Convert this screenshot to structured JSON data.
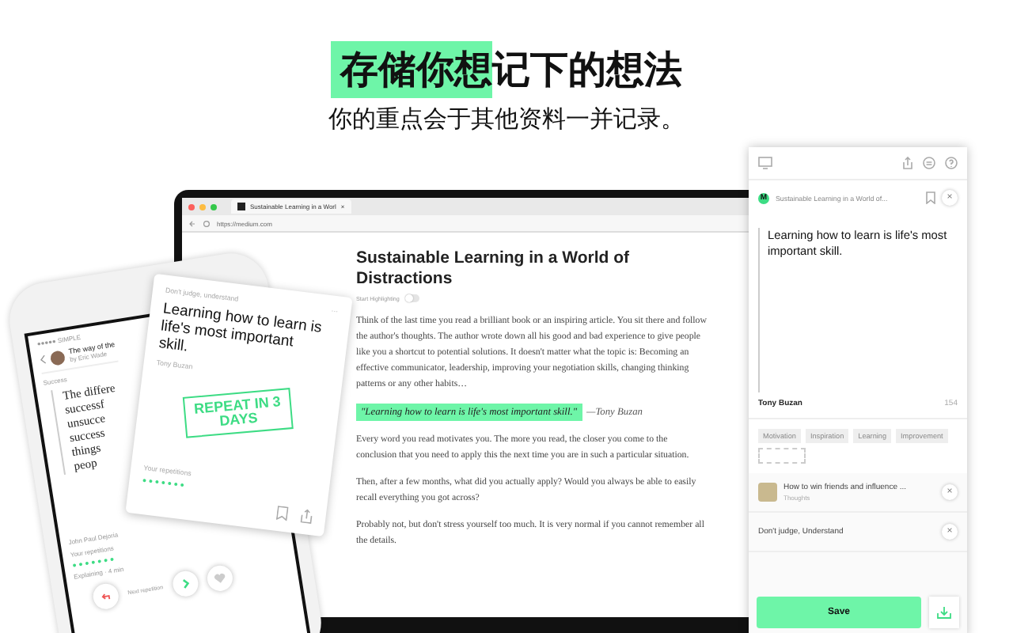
{
  "headline": {
    "highlight": "存储你想",
    "rest": "记下的想法",
    "subtitle": "你的重点会于其他资料一并记录。"
  },
  "browser": {
    "tab_title": "Sustainable Learning in a Worl",
    "tab_close": "×",
    "url": "https://medium.com"
  },
  "article": {
    "title": "Sustainable Learning in a World of Distractions",
    "toggle_label": "Start Highlighting",
    "highlighting_on": false,
    "paragraphs": [
      {
        "kind": "text",
        "text": "Think of the last time you read a brilliant book or an inspiring article. You sit there and follow the author's thoughts. The author wrote down all his good and bad experience to give people like you a shortcut to potential solutions. It doesn't matter what the topic is: Becoming an effective communicator, leadership, improving your negotiation skills, changing thinking patterns or any other habits…"
      },
      {
        "kind": "quote",
        "text": "\"Learning how to learn is life's most important skill.\"",
        "author": "—Tony Buzan"
      },
      {
        "kind": "text",
        "text": "Every word you read motivates you. The more you read, the closer you come to the conclusion that you need to apply this the next time you are in such a particular situation."
      },
      {
        "kind": "text",
        "text": "Then, after a few months, what did you actually apply? Would you always be able to easily recall everything you got across?"
      },
      {
        "kind": "text",
        "text": "Probably not, but don't stress yourself too much. It is very normal if you cannot remember all the details."
      }
    ]
  },
  "panel": {
    "source_badge": "M",
    "source_title": "Sustainable Learning in a World of...",
    "close": "×",
    "quote": "Learning how to learn is life's most important skill.",
    "author": "Tony Buzan",
    "count": "154",
    "tags": [
      "Motivation",
      "Inspiration",
      "Learning",
      "Improvement"
    ],
    "collections": [
      {
        "title": "How to win friends and influence ...",
        "subtitle": "Thoughts",
        "has_thumb": true,
        "close": "×"
      },
      {
        "title": "Don't judge, Understand",
        "has_thumb": false,
        "close": "×"
      }
    ],
    "save_label": "Save"
  },
  "phone": {
    "status": "●●●●● SIMPLE",
    "header_title": "The way of the",
    "header_sub": "by Eric Wade",
    "section": "Success",
    "lines": [
      "The differe",
      "successf",
      "unsucce",
      "success",
      "things",
      "peop"
    ],
    "author": "John Paul Dejoria",
    "repetitions_label": "Your repetitions",
    "footer": "Explaining · 4 min",
    "next_label": "Next repetition"
  },
  "card": {
    "category": "Don't judge, understand",
    "more": "···",
    "quote": "Learning how to learn is life's most important skill.",
    "author": "Tony Buzan",
    "stamp": "REPEAT IN 3 DAYS",
    "repetitions_label": "Your repetitions"
  }
}
